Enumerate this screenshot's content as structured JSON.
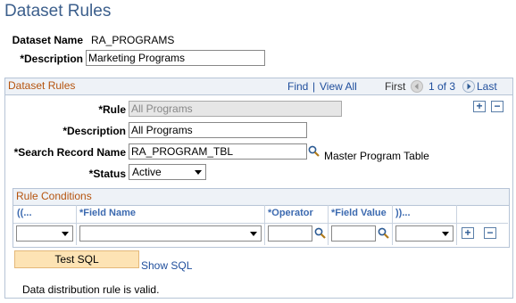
{
  "page": {
    "title": "Dataset Rules"
  },
  "dataset": {
    "name_label": "Dataset Name",
    "name_value": "RA_PROGRAMS",
    "desc_label": "*Description",
    "desc_value": "Marketing Programs"
  },
  "rules_section": {
    "title": "Dataset Rules",
    "find": "Find",
    "separator": "|",
    "view_all": "View All",
    "first": "First",
    "position": "1 of 3",
    "last": "Last",
    "rule_label": "*Rule",
    "rule_value": "All Programs",
    "desc_label": "*Description",
    "desc_value": "All Programs",
    "search_label": "*Search Record Name",
    "search_value": "RA_PROGRAM_TBL",
    "search_desc": "Master Program Table",
    "status_label": "*Status",
    "status_value": "Active"
  },
  "conditions": {
    "title": "Rule Conditions",
    "columns": [
      "((...",
      "*Field Name",
      "*Operator",
      "*Field Value",
      "))..."
    ],
    "row": {
      "open_paren": "",
      "field_name": "",
      "operator": "",
      "field_value": "",
      "close_paren": ""
    }
  },
  "actions": {
    "test_sql": "Test SQL",
    "show_sql": "Show SQL",
    "message": "Data distribution rule is valid."
  },
  "icons": {
    "add": "plus-icon",
    "remove": "minus-icon",
    "lookup": "magnifier-icon",
    "prev": "arrow-left-icon",
    "next": "arrow-right-icon"
  },
  "colors": {
    "title": "#3c5f8c",
    "section_title": "#b5530d",
    "link": "#1f4e9c",
    "button": "#fde3b4"
  }
}
